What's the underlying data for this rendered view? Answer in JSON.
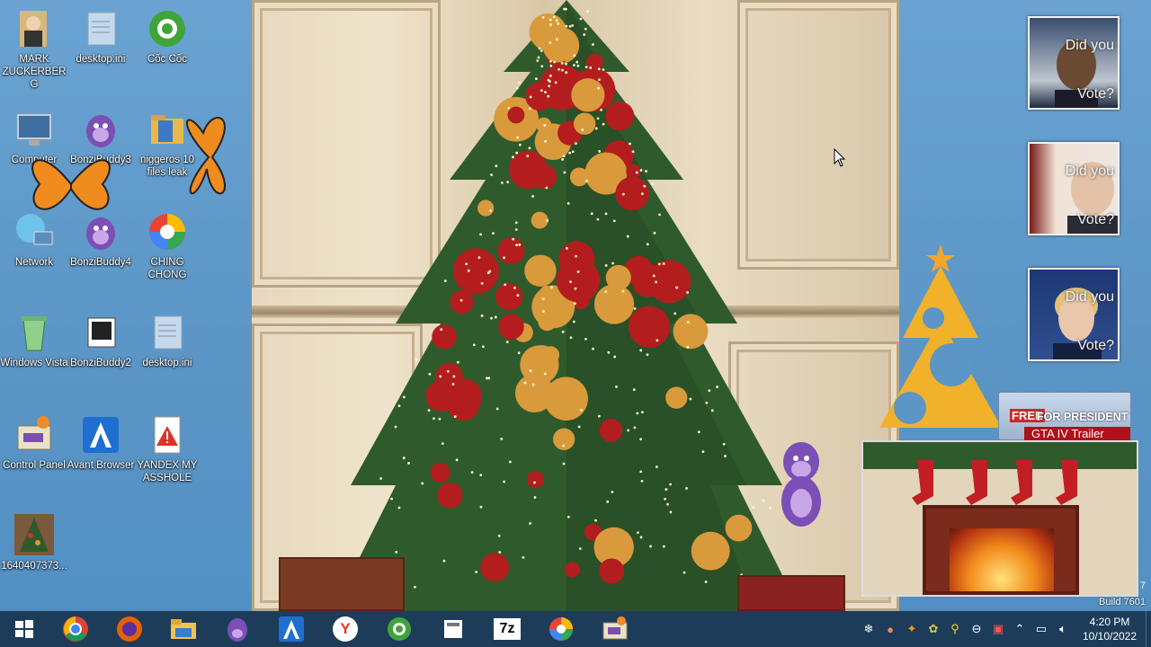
{
  "desktop_icons": [
    {
      "id": "mark",
      "label": "MARK ZUCKERBERG",
      "icon": "person-folder-icon"
    },
    {
      "id": "ini1",
      "label": "desktop.ini",
      "icon": "ini-file-icon"
    },
    {
      "id": "coccoc",
      "label": "Cốc Cốc",
      "icon": "coccoc-browser-icon"
    },
    {
      "id": "computer",
      "label": "Computer",
      "icon": "computer-icon"
    },
    {
      "id": "bonzi3",
      "label": "BonziBuddy3",
      "icon": "bonzibuddy-icon"
    },
    {
      "id": "niggeros",
      "label": "niggeros 10 files leak",
      "icon": "folder-icon"
    },
    {
      "id": "network",
      "label": "Network",
      "icon": "network-icon"
    },
    {
      "id": "bonzi4",
      "label": "BonziBuddy4",
      "icon": "bonzibuddy-icon"
    },
    {
      "id": "ching",
      "label": "CHING CHONG",
      "icon": "colorful-app-icon"
    },
    {
      "id": "vista",
      "label": "Windows Vista",
      "icon": "recycle-bin-icon"
    },
    {
      "id": "bonzi2",
      "label": "BonziBuddy2",
      "icon": "shortcut-icon"
    },
    {
      "id": "ini2",
      "label": "desktop.ini",
      "icon": "ini-file-icon"
    },
    {
      "id": "control",
      "label": "Control Panel",
      "icon": "control-panel-icon"
    },
    {
      "id": "avant",
      "label": "Avant Browser",
      "icon": "avant-browser-icon"
    },
    {
      "id": "yandex",
      "label": "YANDEX MY ASSHOLE",
      "icon": "warning-file-icon"
    },
    {
      "id": "image",
      "label": "1640407373...",
      "icon": "image-thumbnail-icon"
    }
  ],
  "vote_widgets": [
    {
      "line1": "Did you",
      "line2": "Vote?"
    },
    {
      "line1": "Did you",
      "line2": "Vote?"
    },
    {
      "line1": "Did you",
      "line2": "Vote?"
    }
  ],
  "banner": {
    "free": "FREE",
    "president": "FOR PRESIDENT",
    "gta": "GTA IV Trailer"
  },
  "build": {
    "line1": "7",
    "line2": "Build 7601"
  },
  "taskbar": {
    "apps": [
      {
        "name": "chrome-icon"
      },
      {
        "name": "firefox-icon"
      },
      {
        "name": "explorer-icon"
      },
      {
        "name": "bonzibuddy-icon"
      },
      {
        "name": "avant-browser-icon"
      },
      {
        "name": "yandex-icon"
      },
      {
        "name": "coccoc-icon"
      },
      {
        "name": "file-icon"
      },
      {
        "name": "7zip-icon"
      },
      {
        "name": "colorful-app-icon"
      },
      {
        "name": "control-panel-icon"
      }
    ],
    "seven_zip_label": "7z",
    "yandex_label": "Y",
    "clock": {
      "time": "4:20 PM",
      "date": "10/10/2022"
    }
  },
  "colors": {
    "desktop": "#5c96c6",
    "taskbar": "#1d3c5a",
    "tree": "#2f5a2c",
    "ornament": "#b31d1d",
    "gold": "#d99a3c"
  }
}
